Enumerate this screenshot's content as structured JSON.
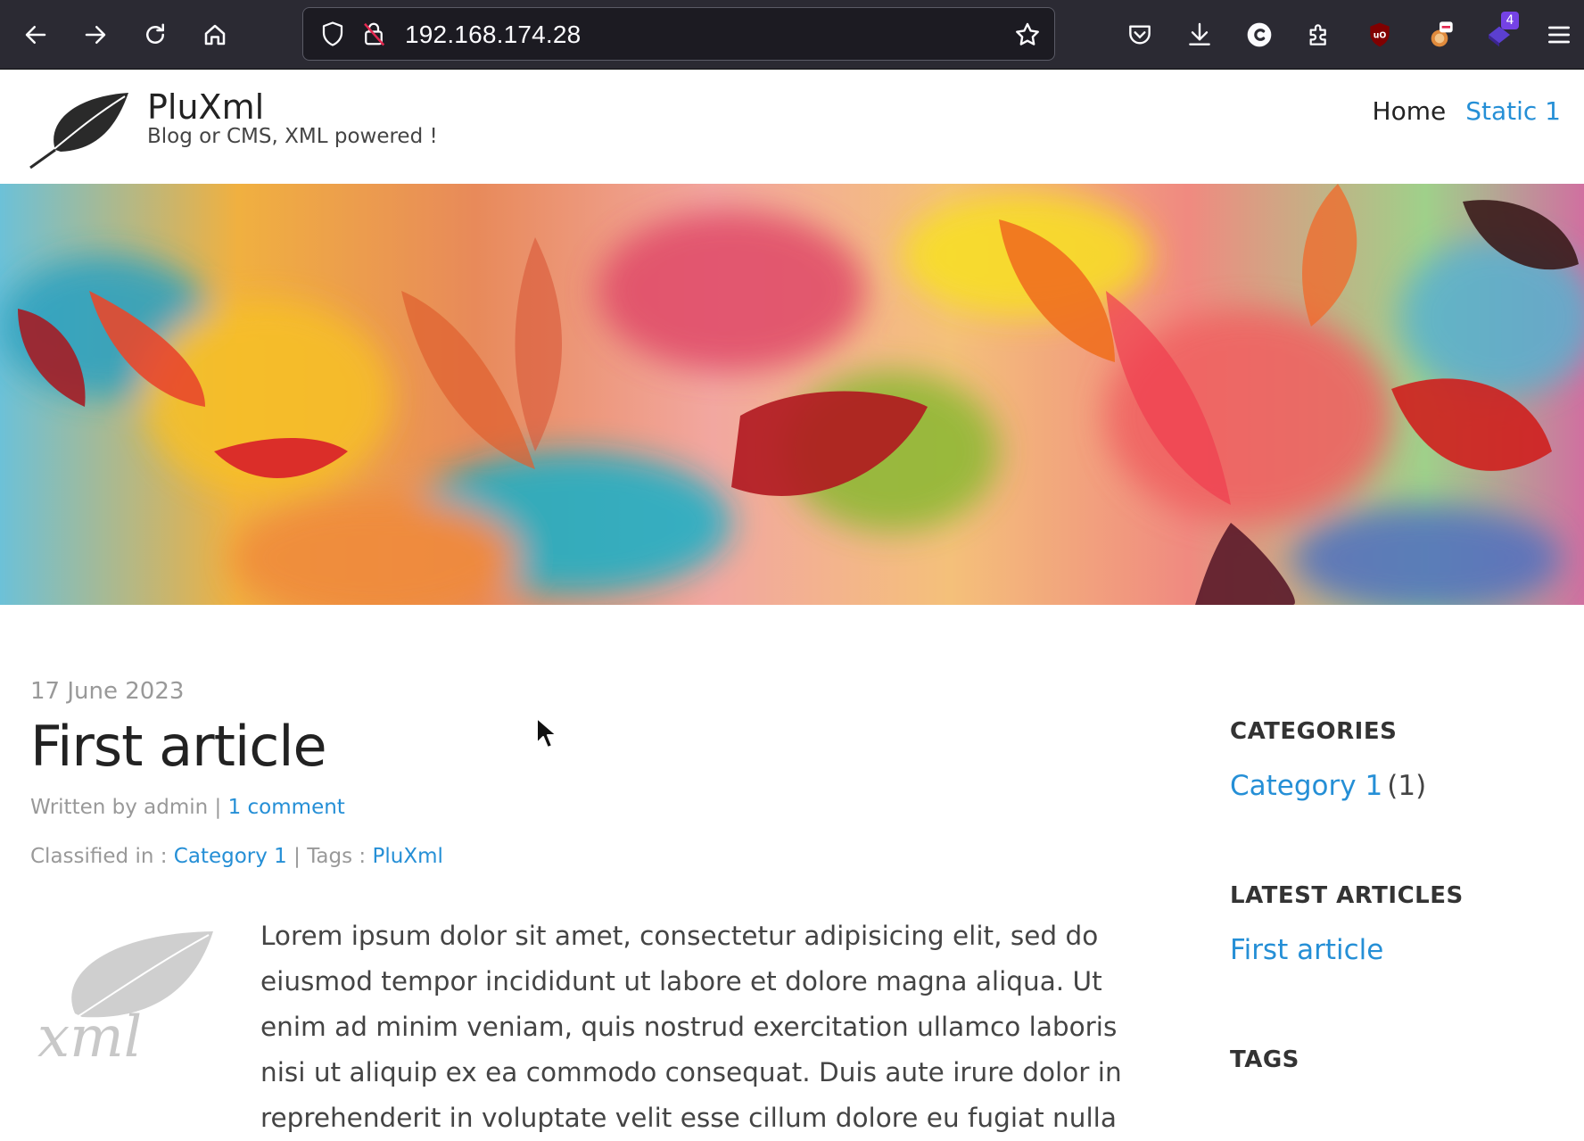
{
  "browser": {
    "url": "192.168.174.28",
    "extension_badge": "4",
    "icons": [
      "back-icon",
      "forward-icon",
      "reload-icon",
      "home-icon",
      "shield-icon",
      "lock-insecure-icon",
      "bookmark-star-icon",
      "pocket-icon",
      "download-icon",
      "extension-c-icon",
      "extensions-icon",
      "ublock-icon",
      "blocker-icon",
      "purple-extension-icon",
      "menu-icon"
    ]
  },
  "site": {
    "title": "PluXml",
    "subtitle": "Blog or CMS, XML powered !",
    "menu": [
      {
        "label": "Home",
        "active": false
      },
      {
        "label": "Static 1",
        "active": true
      }
    ]
  },
  "article": {
    "date": "17 June 2023",
    "title": "First article",
    "written_by_prefix": "Written by admin",
    "separator": "|",
    "comment_link": "1 comment",
    "classified_prefix": "Classified in :",
    "category_link": "Category 1",
    "tags_prefix": "Tags :",
    "tag_link": "PluXml",
    "body": "Lorem ipsum dolor sit amet, consectetur adipisicing elit, sed do eiusmod tempor incididunt ut labore et dolore magna aliqua. Ut enim ad minim veniam, quis nostrud exercitation ullamco laboris nisi ut aliquip ex ea commodo consequat. Duis aute irure dolor in reprehenderit in voluptate velit esse cillum dolore eu fugiat nulla"
  },
  "sidebar": {
    "categories_heading": "CATEGORIES",
    "category_link": "Category 1",
    "category_count": "(1)",
    "latest_heading": "LATEST ARTICLES",
    "latest_link": "First article",
    "tags_heading": "TAGS"
  },
  "colors": {
    "link": "#258fd6",
    "chrome_bg": "#2b2a33",
    "urlbar_bg": "#1c1b22"
  }
}
